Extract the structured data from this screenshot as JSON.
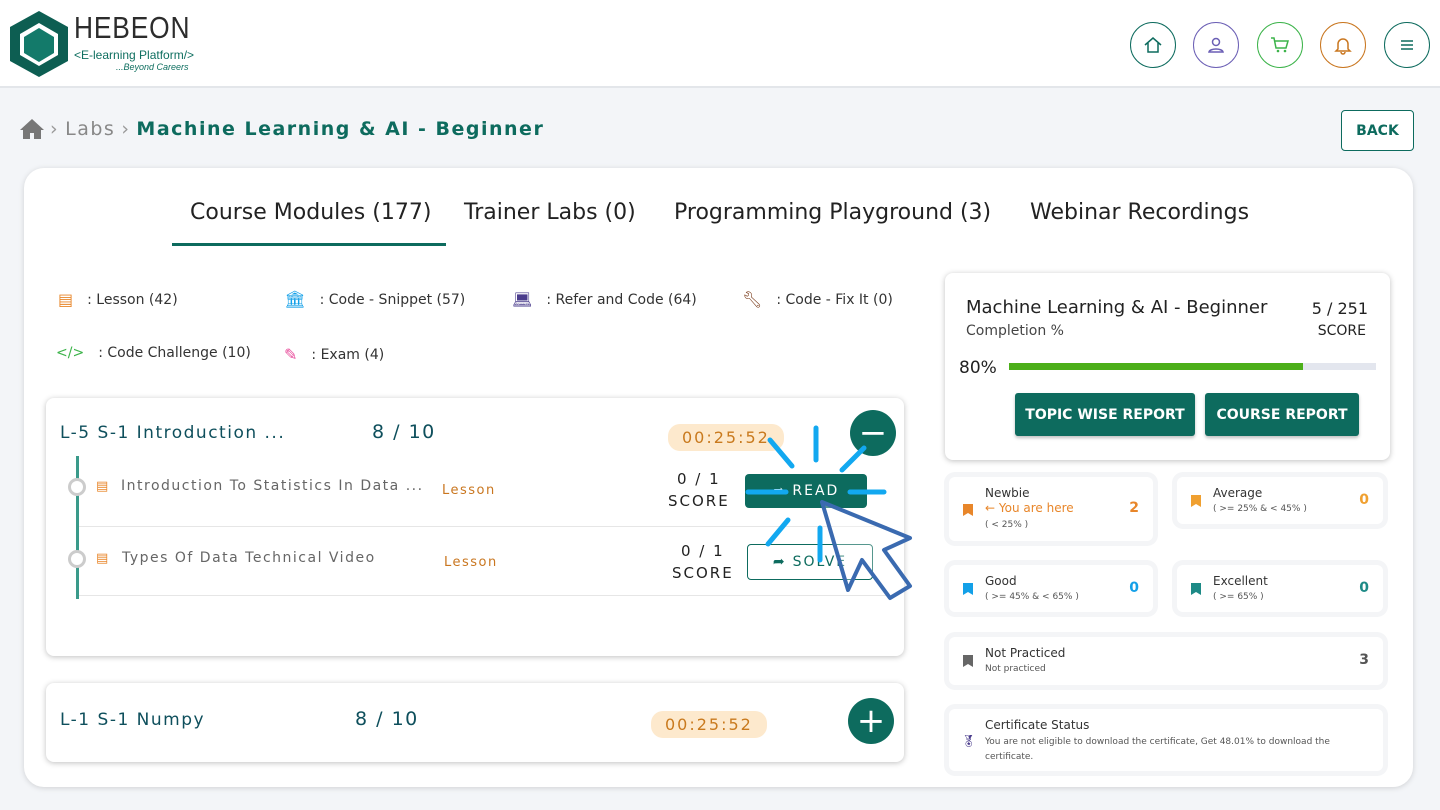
{
  "header": {
    "brand": "HEBEON",
    "tagline": "<E-learning Platform/>",
    "subtag": "...Beyond Careers",
    "icons": [
      {
        "name": "home-icon",
        "color": "#0d6b5e"
      },
      {
        "name": "user-icon",
        "color": "#6b5fb5"
      },
      {
        "name": "cart-icon",
        "color": "#3cb34a"
      },
      {
        "name": "bell-icon",
        "color": "#c9761f"
      },
      {
        "name": "menu-icon",
        "color": "#0d6b5e"
      }
    ]
  },
  "breadcrumb": {
    "items": [
      "Labs"
    ],
    "current": "Machine Learning & AI - Beginner"
  },
  "back_label": "BACK",
  "tabs": [
    "Course Modules (177)",
    "Trainer Labs (0)",
    "Programming Playground (3)",
    "Webinar Recordings"
  ],
  "legend": [
    ": Lesson (42)",
    ": Code - Snippet (57)",
    ": Refer and Code (64)",
    ": Code - Fix It (0)",
    ": Code Challenge (10)",
    ": Exam (4)"
  ],
  "modules": [
    {
      "title": "L-5 S-1 Introduction ...",
      "progress": "8 / 10",
      "timer": "00:25:52",
      "expanded": true,
      "items": [
        {
          "title": "Introduction To Statistics In Data ...",
          "type": "Lesson",
          "score": "0 / 1",
          "score_label": "SCORE",
          "action": "READ"
        },
        {
          "title": "Types Of Data Technical Video",
          "type": "Lesson",
          "score": "0 / 1",
          "score_label": "SCORE",
          "action": "SOLVE"
        }
      ]
    },
    {
      "title": "L-1 S-1 Numpy",
      "progress": "8 / 10",
      "timer": "00:25:52",
      "expanded": false
    }
  ],
  "summary": {
    "title": "Machine Learning & AI - Beginner",
    "completion_label": "Completion %",
    "score": "5 / 251",
    "score_label": "SCORE",
    "percent_text": "80%",
    "percent": 80,
    "btn_topic": "TOPIC WISE REPORT",
    "btn_course": "COURSE REPORT",
    "accent": "#4caf1a"
  },
  "stats": {
    "newbie": {
      "name": "Newbie",
      "here": "← You are here",
      "range": "( < 25% )",
      "value": "2",
      "color": "#e8862a"
    },
    "average": {
      "name": "Average",
      "range": "( >= 25% & < 45% )",
      "value": "0",
      "color": "#f0a030"
    },
    "good": {
      "name": "Good",
      "range": "( >= 45% & < 65% )",
      "value": "0",
      "color": "#13a0e8"
    },
    "excellent": {
      "name": "Excellent",
      "range": "( >= 65% )",
      "value": "0",
      "color": "#1d8a86"
    },
    "not_practiced": {
      "name": "Not Practiced",
      "range": "Not practiced",
      "value": "3",
      "color": "#555"
    },
    "certificate": {
      "name": "Certificate Status",
      "text": "You are not eligible to download the certificate, Get 48.01% to download the certificate."
    }
  }
}
